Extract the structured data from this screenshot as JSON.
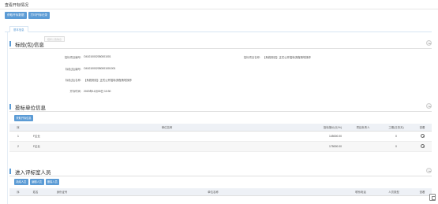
{
  "window": {
    "title": "查看开标情况"
  },
  "toolbar": {
    "buttons": [
      "获取开标数据",
      "打印开标记录"
    ]
  },
  "tab": {
    "label": "基本信息"
  },
  "ghost_button": {
    "label": "招标公告信息"
  },
  "section1": {
    "title": "标段(包)信息",
    "fields": {
      "project_no_label": "招标项目编号:",
      "project_no_value": "O41010002050001001",
      "project_name_label": "招标项目名称:",
      "project_name_value": "【系统测试】正式公开招标流程请勿操作",
      "bid_no_label": "标段(包)编号:",
      "bid_no_value": "O41010002050001001001",
      "bid_name_label": "标段(包)名称:",
      "bid_name_value": "【系统测试】正式公开招标流程请勿操作",
      "open_time_label": "开标时间:",
      "open_time_value": "2020年11月30日 10:30"
    }
  },
  "section2": {
    "title": "投标单位信息",
    "button": "获取开标信息",
    "columns": [
      "序",
      "单位名称",
      "投标报价(元/%)",
      "项目负责人",
      "工期(日历天)",
      "查看"
    ],
    "rows": [
      {
        "no": "1",
        "name": "F企业",
        "price": "145000.00",
        "manager": "",
        "period": "0"
      },
      {
        "no": "2",
        "name": "F企业",
        "price": "175000.00",
        "manager": "",
        "period": "0"
      }
    ]
  },
  "section3": {
    "title": "进入评标室人员",
    "buttons": [
      "新增人员",
      "编辑人员",
      "删除人员"
    ],
    "columns": [
      "序",
      "姓名",
      "身份证号",
      "单位名称",
      "联系电话",
      "人员类型",
      "查看"
    ]
  },
  "icons": {
    "collapse": "minus-circle-icon",
    "view": "search-icon",
    "corner": "copy-icon"
  },
  "colors": {
    "accent": "#5b9bd5"
  }
}
